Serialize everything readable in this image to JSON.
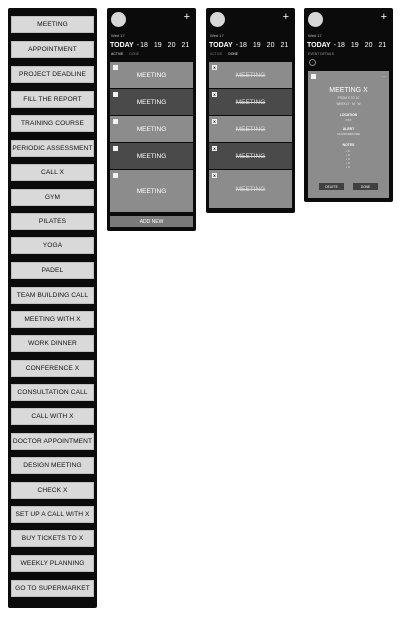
{
  "list": {
    "items": [
      "MEETING",
      "APPOINTMENT",
      "PROJECT DEADLINE",
      "FILL THE REPORT",
      "TRAINING COURSE",
      "PERIODIC ASSESSMENT",
      "CALL X",
      "GYM",
      "PILATES",
      "YOGA",
      "PADEL",
      "TEAM BUILDING CALL",
      "MEETING WITH X",
      "WORK DINNER",
      "CONFERENCE X",
      "CONSULTATION CALL",
      "CALL WITH X",
      "DOCTOR APPOINTMENT",
      "DESIGN MEETING",
      "CHECK X",
      "SET UP A CALL WITH X",
      "BUY TICKETS TO X",
      "WEEKLY PLANNING",
      "GO TO SUPERMARKET"
    ]
  },
  "header": {
    "date_small": "Wed 17",
    "today": "TODAY",
    "dash": "-",
    "days": [
      "18",
      "19",
      "20",
      "21"
    ],
    "plus": "+"
  },
  "active_panel": {
    "tabs": [
      "ACTIVE",
      "DONE"
    ],
    "tasks": [
      "MEETING",
      "MEETING",
      "MEETING",
      "MEETING",
      "MEETING"
    ],
    "add_new": "ADD NEW"
  },
  "done_panel": {
    "tabs": [
      "ACTIVE",
      "DONE"
    ],
    "tasks": [
      "MEETING",
      "MEETING",
      "MEETING",
      "MEETING",
      "MEETING"
    ],
    "check_mark": "X"
  },
  "detail_panel": {
    "event_details_label": "EVENT DETAILS",
    "back_glyph": "<",
    "close_glyph": "—",
    "title": "MEETING X",
    "time": "FROM 9 TO 10",
    "repeat": "WEEKLY · M · W",
    "location_label": "LOCATION",
    "location_value": "XXX",
    "alert_label": "ALERT",
    "alert_value": "10 MIN BEFORE",
    "notes_label": "NOTES",
    "notes": [
      "• X",
      "• X",
      "• X",
      "• X",
      "• X"
    ],
    "delete_label": "DELETE",
    "done_label": "DONE"
  },
  "colors": {
    "panel_bg": "#0b0b0b",
    "list_item_bg": "#d9d9d9",
    "task_light": "#8c8c8c",
    "task_dark": "#4a4a4a"
  }
}
